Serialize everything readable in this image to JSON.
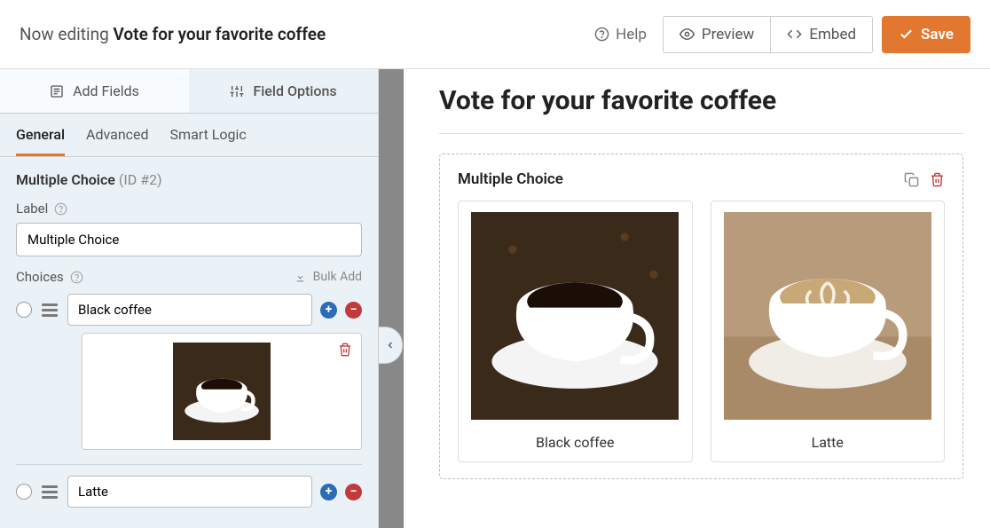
{
  "header": {
    "editing_prefix": "Now editing ",
    "form_title": "Vote for your favorite coffee",
    "help_label": "Help",
    "preview_label": "Preview",
    "embed_label": "Embed",
    "save_label": "Save"
  },
  "sidebar": {
    "tabs": {
      "add_fields": "Add Fields",
      "field_options": "Field Options"
    },
    "subtabs": {
      "general": "General",
      "advanced": "Advanced",
      "smart_logic": "Smart Logic"
    }
  },
  "field": {
    "type_label": "Multiple Choice",
    "id_label": "(ID #2)",
    "label_caption": "Label",
    "label_value": "Multiple Choice",
    "choices_caption": "Choices",
    "bulk_add_label": "Bulk Add"
  },
  "choices": [
    {
      "value": "Black coffee"
    },
    {
      "value": "Latte"
    }
  ],
  "preview": {
    "title": "Vote for your favorite coffee",
    "field_title": "Multiple Choice",
    "options": [
      {
        "label": "Black coffee"
      },
      {
        "label": "Latte"
      }
    ]
  },
  "icons": {
    "help": "help-circle-icon",
    "eye": "eye-icon",
    "code": "code-icon",
    "check": "check-icon",
    "form": "form-icon",
    "sliders": "sliders-icon",
    "download": "download-icon",
    "plus": "plus-circle-icon",
    "minus": "minus-circle-icon",
    "trash": "trash-icon",
    "duplicate": "duplicate-icon",
    "chevron_left": "chevron-left-icon"
  },
  "colors": {
    "accent": "#e27730",
    "danger": "#c23b3b",
    "blue": "#2a6db5"
  }
}
